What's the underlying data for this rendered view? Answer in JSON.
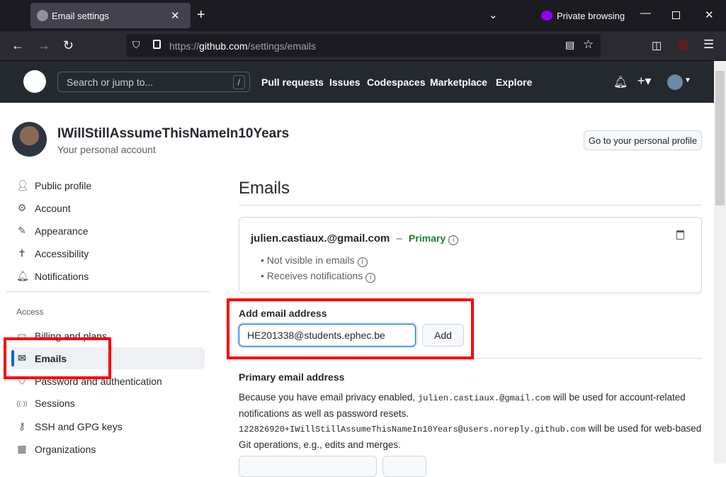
{
  "browser": {
    "tab_title": "Email settings",
    "private_label": "Private browsing",
    "url_prefix": "https://",
    "url_host": "github.com",
    "url_path": "/settings/emails"
  },
  "header": {
    "search_placeholder": "Search or jump to...",
    "search_key": "/",
    "nav": [
      "Pull requests",
      "Issues",
      "Codespaces",
      "Marketplace",
      "Explore"
    ]
  },
  "profile": {
    "name": "IWillStillAssumeThisNameIn10Years",
    "subtitle": "Your personal account",
    "profile_button": "Go to your personal profile"
  },
  "sidebar": {
    "items": [
      {
        "label": "Public profile",
        "icon": "person-icon"
      },
      {
        "label": "Account",
        "icon": "gear-icon"
      },
      {
        "label": "Appearance",
        "icon": "paintbrush-icon"
      },
      {
        "label": "Accessibility",
        "icon": "accessibility-icon"
      },
      {
        "label": "Notifications",
        "icon": "bell-icon"
      }
    ],
    "section": "Access",
    "access_items": [
      {
        "label": "Billing and plans",
        "icon": "credit-card-icon"
      },
      {
        "label": "Emails",
        "icon": "mail-icon",
        "active": true
      },
      {
        "label": "Password and authentication",
        "icon": "shield-lock-icon"
      },
      {
        "label": "Sessions",
        "icon": "broadcast-icon"
      },
      {
        "label": "SSH and GPG keys",
        "icon": "key-icon"
      },
      {
        "label": "Organizations",
        "icon": "organization-icon"
      }
    ]
  },
  "main": {
    "title": "Emails",
    "email": {
      "address": "julien.castiaux.@gmail.com",
      "separator": "–",
      "badge": "Primary",
      "notes": [
        "Not visible in emails",
        "Receives notifications"
      ]
    },
    "add": {
      "label": "Add email address",
      "value": "HE201338@students.ephec.be",
      "button": "Add"
    },
    "primary": {
      "heading": "Primary email address",
      "t1": "Because you have email privacy enabled, ",
      "code1": "julien.castiaux.@gmail.com",
      "t2": " will be used for account-related notifications as well as password resets.",
      "code2": "122826920+IWillStillAssumeThisNameIn10Years@users.noreply.github.com",
      "t3": " will be used for web-based Git operations, e.g., edits and merges."
    }
  },
  "colors": {
    "accent": "#0969da",
    "primary_badge": "#1a7f37",
    "highlight": "#ff0000"
  }
}
